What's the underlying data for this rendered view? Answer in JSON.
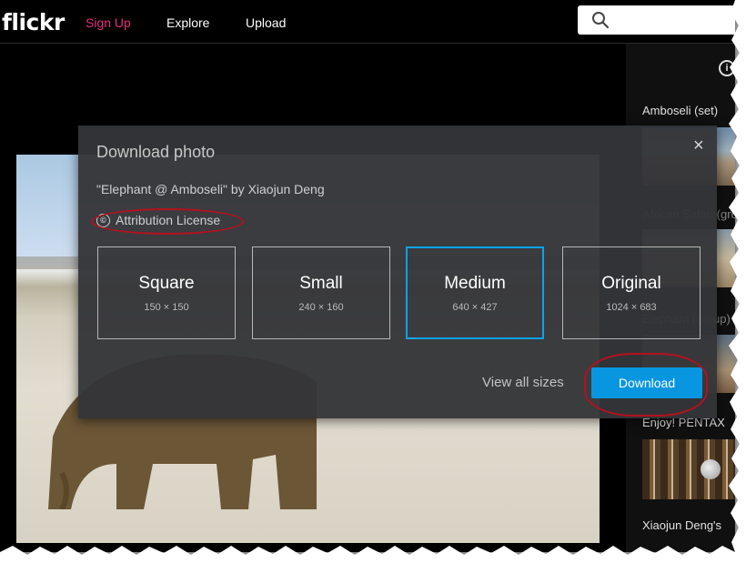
{
  "header": {
    "logo": "flickr",
    "nav": [
      "Sign Up",
      "Explore",
      "Upload"
    ],
    "search_icon": "search-icon"
  },
  "sidebar": {
    "info_icon": "i",
    "items": [
      "Amboseli (set)",
      "African Safari (gro",
      "Elephant (group)",
      "Enjoy! PENTAX",
      "Xiaojun Deng's"
    ]
  },
  "modal": {
    "title": "Download photo",
    "close_icon": "×",
    "photo_title": "\"Elephant @ Amboseli\" by Xiaojun Deng",
    "license_icon": "©",
    "license": "Attribution License",
    "sizes": [
      {
        "name": "Square",
        "dims": "150 × 150"
      },
      {
        "name": "Small",
        "dims": "240 × 160"
      },
      {
        "name": "Medium",
        "dims": "640 × 427"
      },
      {
        "name": "Original",
        "dims": "1024 × 683"
      }
    ],
    "selected_size": "Medium",
    "view_all": "View all sizes",
    "download": "Download"
  },
  "colors": {
    "signup": "#e8307a",
    "selected_border": "#0aa3ec",
    "download_button": "#0896e0",
    "annotation_oval": "#b3111f"
  }
}
